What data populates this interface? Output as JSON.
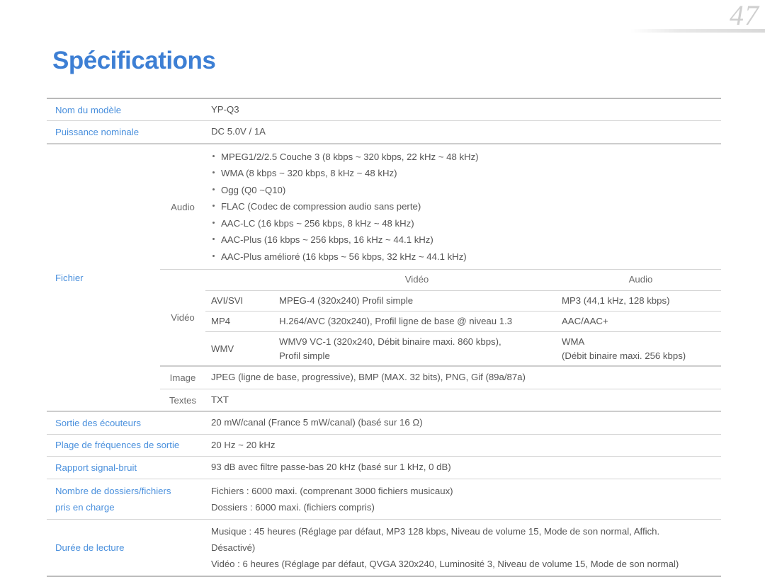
{
  "page": {
    "folio": "47",
    "title": "Spécifications"
  },
  "specs": {
    "model_name": {
      "label": "Nom du modèle",
      "value": "YP-Q3"
    },
    "rated_power": {
      "label": "Puissance nominale",
      "value": "DC 5.0V / 1A"
    },
    "file": {
      "label": "Fichier",
      "audio": {
        "label": "Audio",
        "items": [
          "MPEG1/2/2.5 Couche 3 (8 kbps ~ 320 kbps, 22 kHz ~ 48 kHz)",
          "WMA (8 kbps ~ 320 kbps, 8 kHz ~ 48 kHz)",
          "Ogg (Q0 ~Q10)",
          "FLAC (Codec de compression audio sans perte)",
          "AAC-LC (16 kbps ~ 256 kbps, 8 kHz ~ 48 kHz)",
          "AAC-Plus (16 kbps ~ 256 kbps, 16 kHz ~ 44.1 kHz)",
          "AAC-Plus amélioré (16 kbps ~ 56 kbps, 32 kHz ~ 44.1 kHz)"
        ]
      },
      "video": {
        "label": "Vidéo",
        "headers": {
          "video": "Vidéo",
          "audio": "Audio"
        },
        "rows": [
          {
            "format": "AVI/SVI",
            "video_codec": "MPEG-4 (320x240) Profil simple",
            "audio_codec": "MP3 (44,1 kHz, 128 kbps)",
            "audio_codec_line2": ""
          },
          {
            "format": "MP4",
            "video_codec": "H.264/AVC (320x240), Profil ligne de base @ niveau 1.3",
            "audio_codec": "AAC/AAC+",
            "audio_codec_line2": ""
          },
          {
            "format": "WMV",
            "video_codec": "WMV9 VC-1 (320x240, Débit binaire maxi. 860 kbps),",
            "video_codec_line2": "Profil simple",
            "audio_codec": "WMA",
            "audio_codec_line2": "(Débit binaire maxi. 256 kbps)"
          }
        ]
      },
      "image": {
        "label": "Image",
        "value": "JPEG (ligne de base, progressive), BMP (MAX. 32 bits), PNG, Gif (89a/87a)"
      },
      "text": {
        "label": "Textes",
        "value": "TXT"
      }
    },
    "headphone_output": {
      "label": "Sortie des écouteurs",
      "value": "20 mW/canal (France 5 mW/canal) (basé sur 16 Ω)"
    },
    "output_frequency_range": {
      "label": "Plage de fréquences de sortie",
      "value": "20 Hz ~ 20 kHz"
    },
    "signal_to_noise": {
      "label": "Rapport signal-bruit",
      "value": "93 dB avec filtre passe-bas 20 kHz (basé sur 1 kHz, 0 dB)"
    },
    "folders_files": {
      "label_line1": "Nombre de dossiers/fichiers",
      "label_line2": "pris en charge",
      "value_line1": "Fichiers : 6000 maxi. (comprenant 3000 fichiers musicaux)",
      "value_line2": "Dossiers : 6000 maxi. (fichiers compris)"
    },
    "play_time": {
      "label": "Durée de lecture",
      "music_line1": "Musique : 45 heures (Réglage par défaut, MP3 128 kbps, Niveau de volume 15, Mode de son normal, Affich.",
      "music_line2": "Désactivé)",
      "video_line1": "Vidéo : 6 heures (Réglage par défaut, QVGA 320x240, Luminosité 3, Niveau de volume 15, Mode de son normal)"
    }
  },
  "colors": {
    "title_blue": "#3d7fd4",
    "label_blue": "#4a90dd",
    "body_gray": "#555555",
    "rule_gray": "#d4d4d4",
    "rule_strong": "#b9b9b9",
    "folio_gray": "#cfcfcf"
  }
}
